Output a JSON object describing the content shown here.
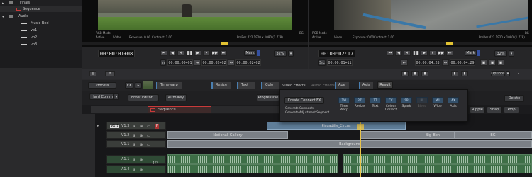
{
  "bin": {
    "items": [
      {
        "label": "Finals"
      },
      {
        "label": "Sequence"
      },
      {
        "label": "Audio"
      },
      {
        "label": "Music Bed"
      },
      {
        "label": "vo1"
      },
      {
        "label": "vo2"
      },
      {
        "label": "vo3"
      }
    ]
  },
  "source_monitor": {
    "mode_label": "RGB Mode",
    "state_label": "Active",
    "video_label": "Video",
    "exposure": "Exposure: 0.00",
    "contrast": "Contrast: 1.00",
    "format": "ProRes 422 1920 x 1080 (1.778)",
    "fit": "BG",
    "timecode": "00:00:01+08",
    "mark_label": "Mark",
    "zoom": "32%",
    "in_label": "In",
    "in_value": "00:00:00+01",
    "out_value": "00:00:02+02",
    "dur_value": "00:00:02+02"
  },
  "record_monitor": {
    "mode_label": "RGB Mode",
    "state_label": "Active",
    "video_label": "Video",
    "exposure": "Exposure: 0.00",
    "contrast": "Contrast: 1.00",
    "format": "ProRes 422 1920 x 1080 (1.778)",
    "fit": "BG",
    "timecode": "00:00:02:17",
    "mark_label": "Mark",
    "zoom": "32%",
    "src_label": "Src",
    "src_value": "00:00:01+11",
    "out_value": "00:00:04:28",
    "dur_value": "00:00:04:29"
  },
  "toolbar": {
    "options_label": "Options",
    "zoom_value": "12",
    "process_label": "Process",
    "fx_label": "FX",
    "timewarp_label": "Timewarp",
    "resize_label": "Resize",
    "text_label": "Text",
    "colour_label": "Colo",
    "video_effects_label": "Video Effects",
    "audio_effects_label": "Audio Effects",
    "axis_label": "Axis",
    "ape_label": "Ape",
    "result_label": "Result",
    "hard_commit_label": "Hard Commit",
    "enter_editor_label": "Enter Editor...",
    "auto_key_label": "Auto Key",
    "progressive_label": "Progressive",
    "delete_label": "Delete",
    "ripple_label": "Ripple",
    "snap_label": "Snap",
    "prop_label": "Prop"
  },
  "fx_popup": {
    "create_label": "Create Connect FX",
    "generate1": "Generate Composite",
    "generate2": "Generate Adjustment Segment",
    "buttons": [
      {
        "code": "TW",
        "label": "Time Warp"
      },
      {
        "code": "RZ",
        "label": "Resize"
      },
      {
        "code": "TT",
        "label": "Text"
      },
      {
        "code": "CC",
        "label": "Colour Correct"
      },
      {
        "code": "SP",
        "label": "Spark"
      },
      {
        "code": "BL",
        "label": "Blend"
      },
      {
        "code": "WI",
        "label": "Wipe"
      },
      {
        "code": "AX",
        "label": "Axis"
      }
    ]
  },
  "timeline": {
    "sequence_name": "Sequence",
    "tracks": [
      {
        "name": "V1.1",
        "sub": "V1.3",
        "flag": "P"
      },
      {
        "name": "V1.2"
      },
      {
        "name": "V1.1"
      },
      {
        "name": "A1.1",
        "meter": "1/2"
      },
      {
        "name": "A1.4"
      }
    ],
    "clips": {
      "top_clip": "Piccadilly_Circus",
      "notional": "Notional_Gallery",
      "big_ben": "Big_Ben",
      "bg": "BG",
      "background": "Background"
    }
  },
  "colors": {
    "accent_red": "#c93a3a",
    "clip_blue": "#5f7e99",
    "clip_grey": "#7b8086",
    "audio_green": "#3d6e46",
    "playhead": "#e8c44a"
  }
}
